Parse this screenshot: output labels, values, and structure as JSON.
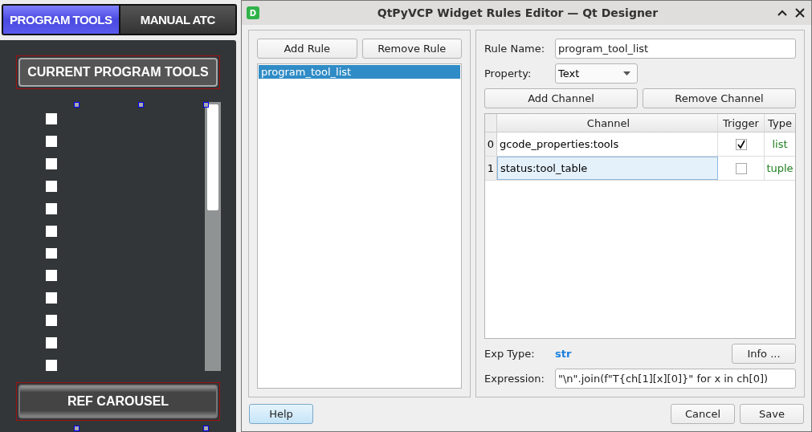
{
  "left_panel": {
    "tabs": [
      {
        "label": "PROGRAM TOOLS",
        "selected": true
      },
      {
        "label": "MANUAL ATC",
        "selected": false
      }
    ],
    "header_button": "CURRENT PROGRAM TOOLS",
    "tool_checkboxes": [
      {
        "checked": false
      },
      {
        "checked": false
      },
      {
        "checked": false
      },
      {
        "checked": false
      },
      {
        "checked": false
      },
      {
        "checked": false
      },
      {
        "checked": false
      },
      {
        "checked": false
      },
      {
        "checked": false
      },
      {
        "checked": false
      },
      {
        "checked": false
      },
      {
        "checked": false
      }
    ],
    "footer_button": "REF CAROUSEL"
  },
  "window": {
    "title": "QtPyVCP Widget Rules Editor — Qt Designer",
    "app_icon": "D"
  },
  "rules": {
    "buttons": [
      "Add Rule",
      "Remove Rule"
    ],
    "items": [
      {
        "label": "program_tool_list",
        "selected": true
      }
    ]
  },
  "editor": {
    "rule_name_label": "Rule Name:",
    "rule_name": "program_tool_list",
    "property_label": "Property:",
    "property": "Text",
    "channel_buttons": [
      "Add Channel",
      "Remove Channel"
    ],
    "table": {
      "columns": [
        "Channel",
        "Trigger",
        "Type"
      ],
      "rows": [
        {
          "index": "0",
          "channel": "gcode_properties:tools",
          "trigger": true,
          "type": "list",
          "selected": false
        },
        {
          "index": "1",
          "channel": "status:tool_table",
          "trigger": false,
          "type": "tuple",
          "selected": true
        }
      ]
    },
    "exp_type_label": "Exp Type:",
    "exp_type": "str",
    "info_button": "Info ...",
    "expression_label": "Expression:",
    "expression": "\"\\n\".join(f\"T{ch[1][x][0]}\" for x in ch[0])"
  },
  "buttons": {
    "help": "Help",
    "cancel": "Cancel",
    "save": "Save"
  }
}
